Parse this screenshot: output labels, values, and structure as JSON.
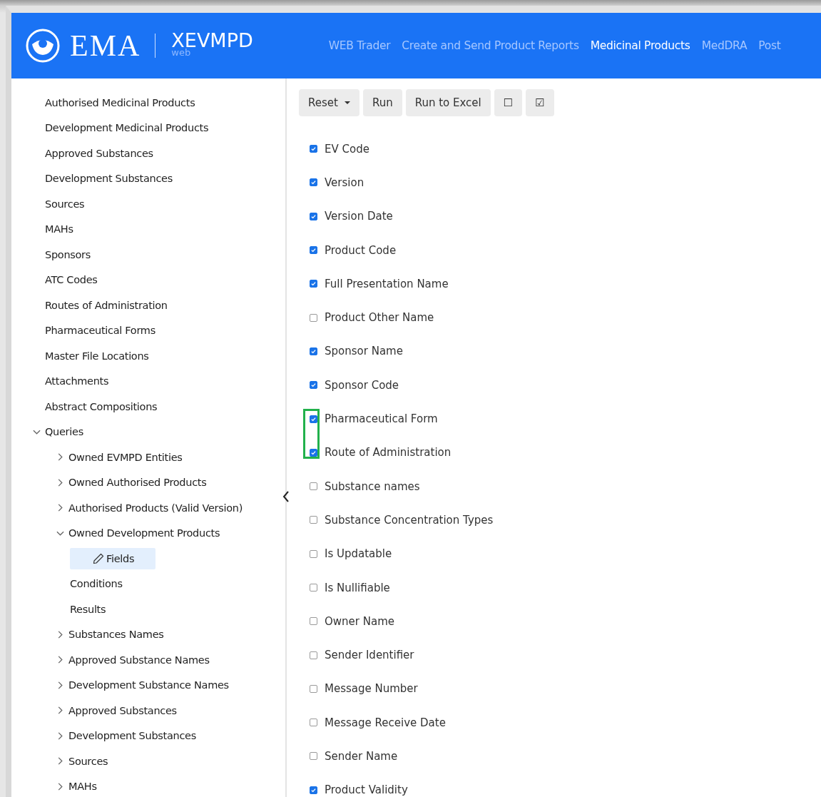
{
  "header": {
    "logo": "EMA",
    "product": "XEVMPD",
    "product_sub": "web",
    "nav": [
      {
        "label": "WEB Trader",
        "selected": false
      },
      {
        "label": "Create and Send Product Reports",
        "selected": false
      },
      {
        "label": "Medicinal Products",
        "selected": true
      },
      {
        "label": "MedDRA",
        "selected": false
      },
      {
        "label": "Post",
        "selected": false
      }
    ]
  },
  "sidebar": {
    "items": [
      {
        "label": "Authorised Medicinal Products",
        "selected": false
      },
      {
        "label": "Development Medicinal Products",
        "selected": false
      },
      {
        "label": "Approved Substances",
        "selected": false
      },
      {
        "label": "Development Substances",
        "selected": false
      },
      {
        "label": "Sources",
        "selected": false
      },
      {
        "label": "MAHs",
        "selected": false
      },
      {
        "label": "Sponsors",
        "selected": false
      },
      {
        "label": "ATC Codes",
        "selected": false
      },
      {
        "label": "Routes of Administration",
        "selected": false
      },
      {
        "label": "Pharmaceutical Forms",
        "selected": false
      },
      {
        "label": "Master File Locations",
        "selected": false
      },
      {
        "label": "Attachments",
        "selected": false
      },
      {
        "label": "Abstract Compositions",
        "selected": false
      },
      {
        "label": "Queries",
        "selected": false,
        "expanded": true,
        "children": [
          {
            "label": "Owned EVMPD Entities",
            "selected": false,
            "expanded": false
          },
          {
            "label": "Owned Authorised Products",
            "selected": false,
            "expanded": false
          },
          {
            "label": "Authorised Products (Valid Version)",
            "selected": false,
            "expanded": false
          },
          {
            "label": "Owned Development Products",
            "selected": false,
            "expanded": true,
            "children": [
              {
                "label": "Fields",
                "selected": true
              },
              {
                "label": "Conditions",
                "selected": false
              },
              {
                "label": "Results",
                "selected": false
              }
            ]
          },
          {
            "label": "Substances Names",
            "selected": false,
            "expanded": false
          },
          {
            "label": "Approved Substance Names",
            "selected": false,
            "expanded": false
          },
          {
            "label": "Development Substance Names",
            "selected": false,
            "expanded": false
          },
          {
            "label": "Approved Substances",
            "selected": false,
            "expanded": false
          },
          {
            "label": "Development Substances",
            "selected": false,
            "expanded": false
          },
          {
            "label": "Sources",
            "selected": false,
            "expanded": false
          },
          {
            "label": "MAHs",
            "selected": false,
            "expanded": false
          }
        ]
      }
    ]
  },
  "toolbar": [
    {
      "label": "Reset",
      "kind": "dropdown"
    },
    {
      "label": "Run",
      "kind": "plain"
    },
    {
      "label": "Run to Excel",
      "kind": "plain"
    },
    {
      "label": "☐",
      "kind": "plain"
    },
    {
      "label": "☑",
      "kind": "plain"
    }
  ],
  "fields": [
    {
      "label": "EV Code",
      "checked": true,
      "highlighted": false
    },
    {
      "label": "Version",
      "checked": true,
      "highlighted": false
    },
    {
      "label": "Version Date",
      "checked": true,
      "highlighted": false
    },
    {
      "label": "Product Code",
      "checked": true,
      "highlighted": false
    },
    {
      "label": "Full Presentation Name",
      "checked": true,
      "highlighted": false
    },
    {
      "label": "Product Other Name",
      "checked": false,
      "highlighted": false
    },
    {
      "label": "Sponsor Name",
      "checked": true,
      "highlighted": false
    },
    {
      "label": "Sponsor Code",
      "checked": true,
      "highlighted": false
    },
    {
      "label": "Pharmaceutical Form",
      "checked": true,
      "highlighted": true
    },
    {
      "label": "Route of Administration",
      "checked": true,
      "highlighted": true
    },
    {
      "label": "Substance names",
      "checked": false,
      "highlighted": false
    },
    {
      "label": "Substance Concentration Types",
      "checked": false,
      "highlighted": false
    },
    {
      "label": "Is Updatable",
      "checked": false,
      "highlighted": false
    },
    {
      "label": "Is Nullifiable",
      "checked": false,
      "highlighted": false
    },
    {
      "label": "Owner Name",
      "checked": false,
      "highlighted": false
    },
    {
      "label": "Sender Identifier",
      "checked": false,
      "highlighted": false
    },
    {
      "label": "Message Number",
      "checked": false,
      "highlighted": false
    },
    {
      "label": "Message Receive Date",
      "checked": false,
      "highlighted": false
    },
    {
      "label": "Sender Name",
      "checked": false,
      "highlighted": false
    },
    {
      "label": "Product Validity",
      "checked": true,
      "highlighted": false
    }
  ]
}
